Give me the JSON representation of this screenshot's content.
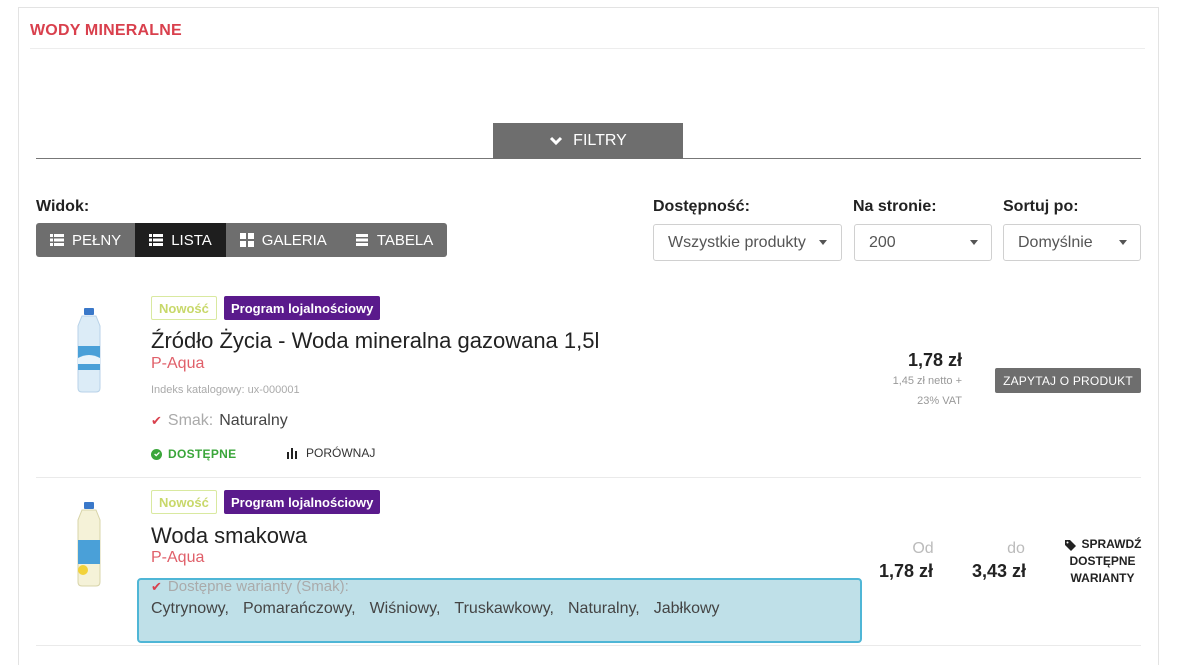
{
  "section": {
    "title": "WODY MINERALNE"
  },
  "filters": {
    "label": "FILTRY"
  },
  "view": {
    "label": "Widok:",
    "options": [
      "PEŁNY",
      "LISTA",
      "GALERIA",
      "TABELA"
    ],
    "active": "LISTA"
  },
  "availability": {
    "label": "Dostępność:",
    "value": "Wszystkie produkty"
  },
  "per_page": {
    "label": "Na stronie:",
    "value": "200"
  },
  "sort": {
    "label": "Sortuj po:",
    "value": "Domyślnie"
  },
  "products": [
    {
      "badges": [
        "Nowość",
        "Program lojalnościowy"
      ],
      "name": "Źródło Życia - Woda mineralna gazowana 1,5l",
      "brand": "P-Aqua",
      "index": "Indeks katalogowy: ux-000001",
      "attr_label": "Smak:",
      "attr_value": "Naturalny",
      "availability": "DOSTĘPNE",
      "compare": "PORÓWNAJ",
      "price": "1,78 zł",
      "price_note_1": "1,45 zł netto +",
      "price_note_2": "23% VAT",
      "ask": "ZAPYTAJ O PRODUKT"
    },
    {
      "badges": [
        "Nowość",
        "Program lojalnościowy"
      ],
      "name": "Woda smakowa",
      "brand": "P-Aqua",
      "variants_label": "Dostępne warianty (Smak):",
      "variants": [
        "Cytrynowy,",
        "Pomarańczowy,",
        "Wiśniowy,",
        "Truskawkowy,",
        "Naturalny,",
        "Jabłkowy"
      ],
      "from_label": "Od",
      "from_price": "1,78 zł",
      "to_label": "do",
      "to_price": "3,43 zł",
      "check_variants": [
        "SPRAWDŹ",
        "DOSTĘPNE",
        "WARIANTY"
      ]
    }
  ],
  "colors": {
    "accent": "#d9404d",
    "loyalty": "#5a1a8c",
    "available": "#3aa63a",
    "button": "#6e6e6e"
  }
}
